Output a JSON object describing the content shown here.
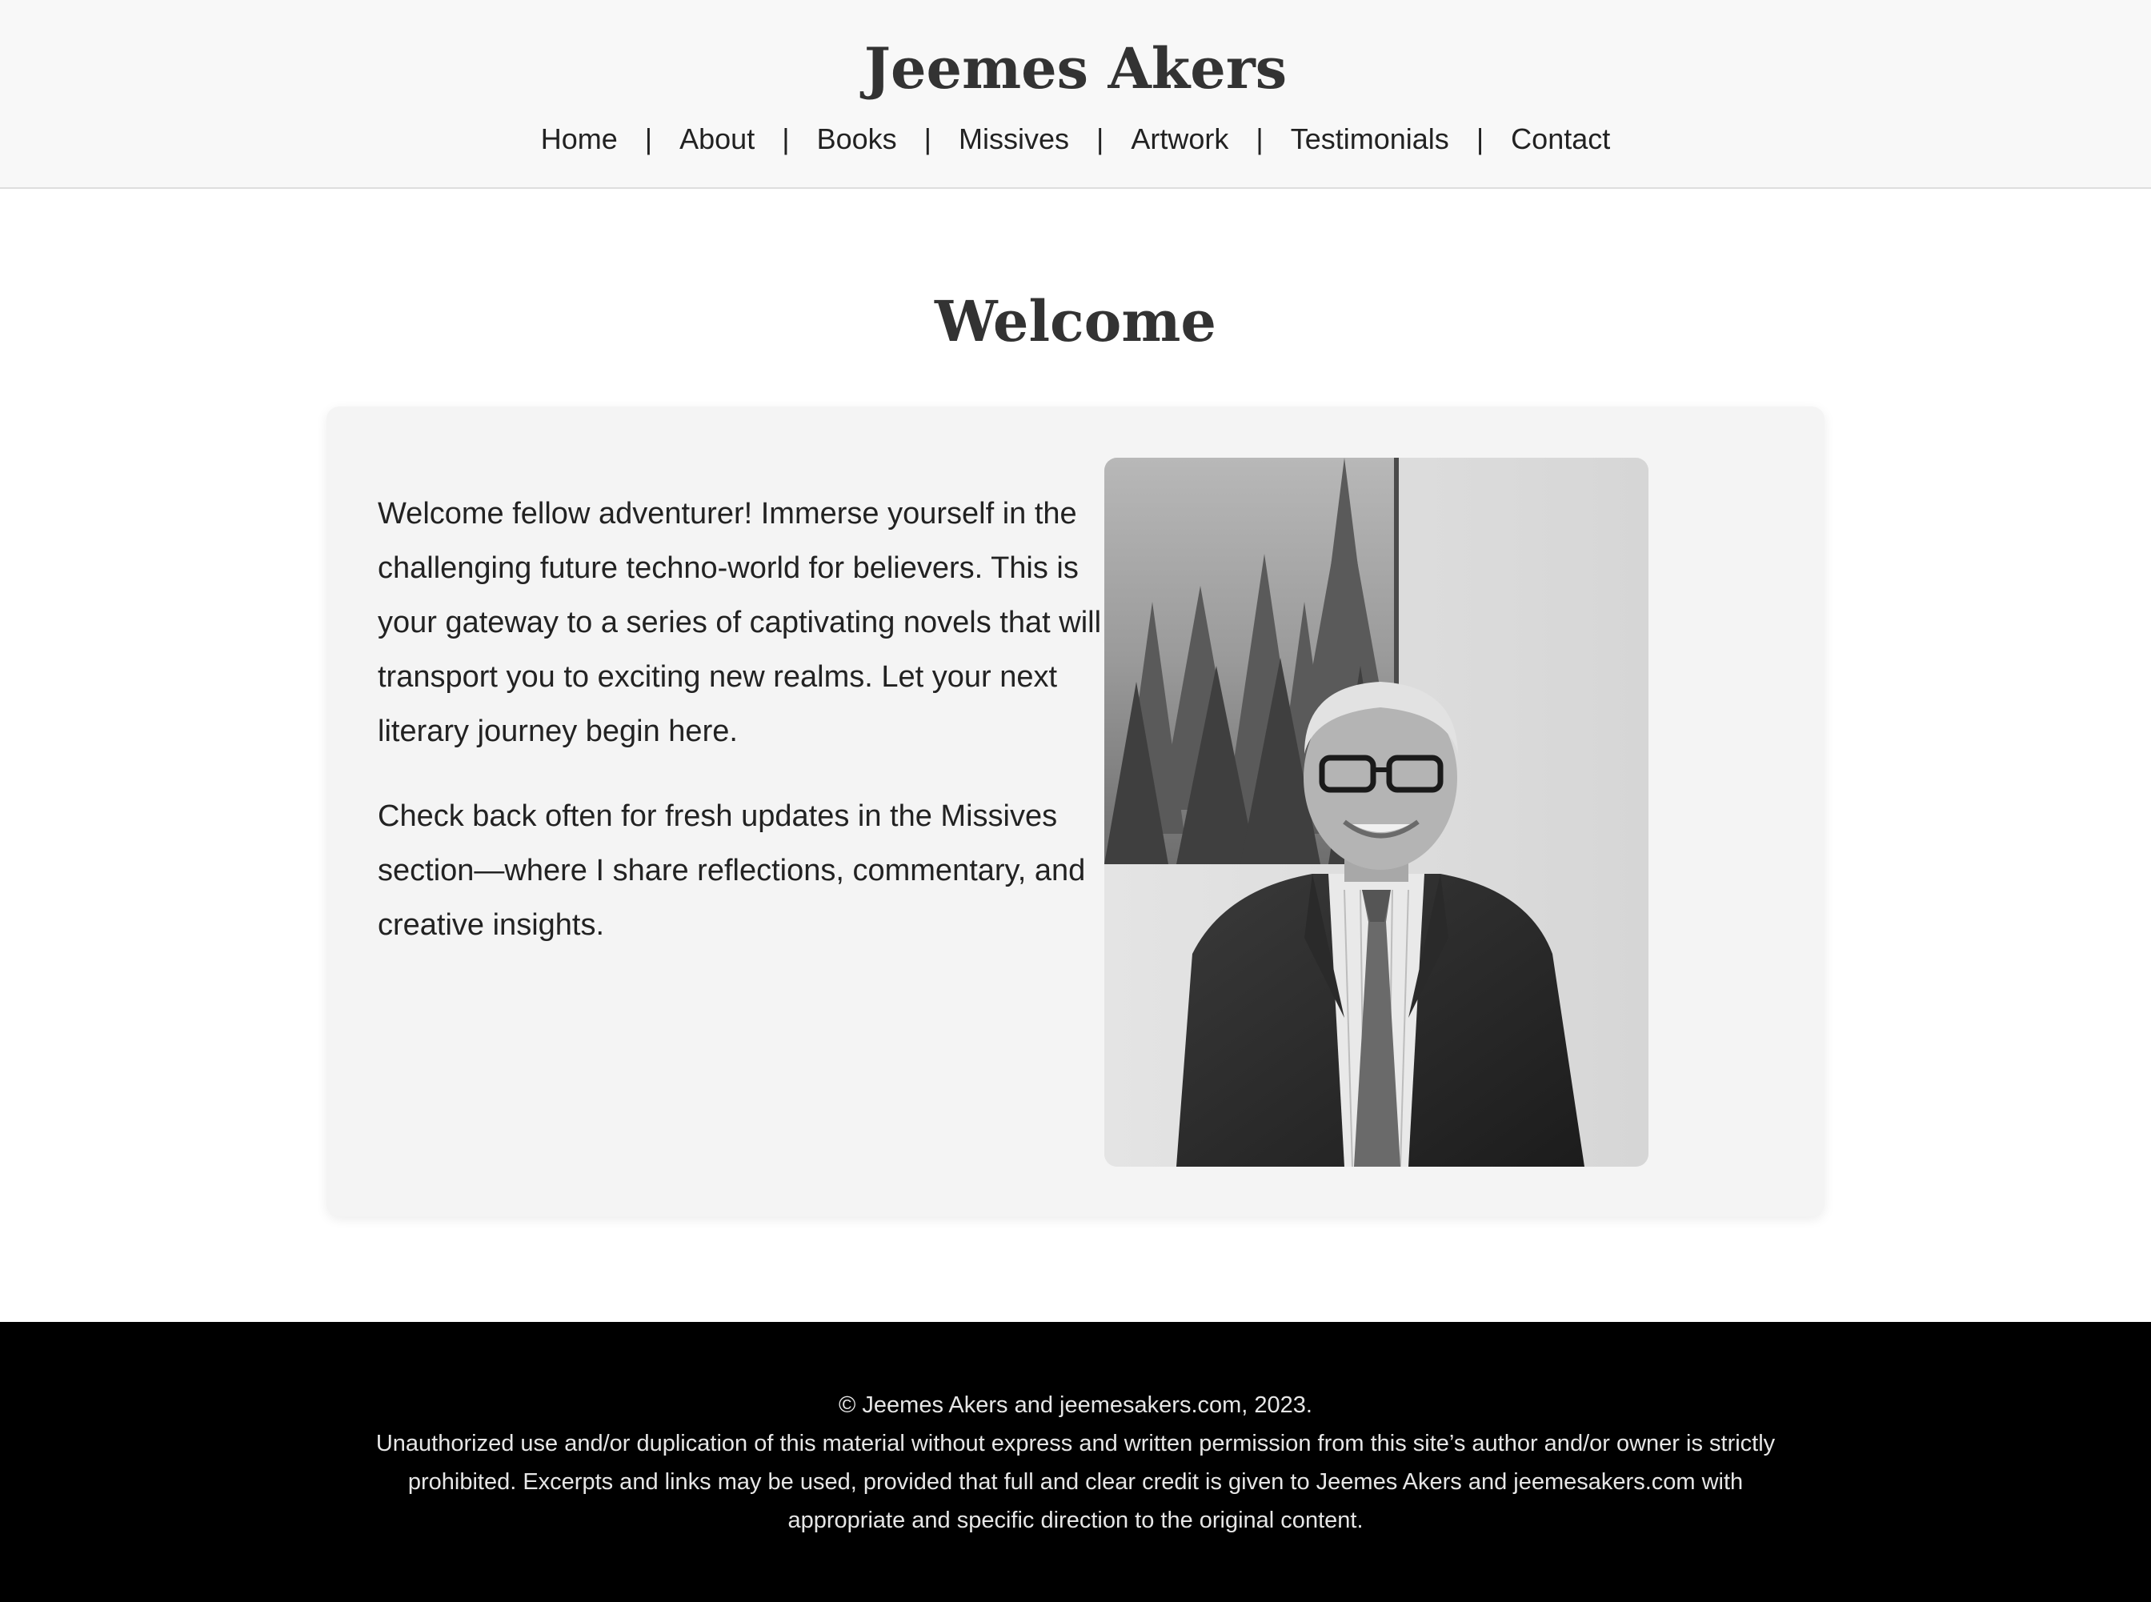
{
  "header": {
    "site_title": "Jeemes Akers",
    "nav": [
      {
        "label": "Home"
      },
      {
        "label": "About"
      },
      {
        "label": "Books"
      },
      {
        "label": "Missives"
      },
      {
        "label": "Artwork"
      },
      {
        "label": "Testimonials"
      },
      {
        "label": "Contact"
      }
    ],
    "separator": "|"
  },
  "main": {
    "heading": "Welcome",
    "paragraphs": [
      "Welcome fellow adventurer! Immerse yourself in the challenging future techno-world for believers. This is your gateway to a series of captivating novels that will transport you to exciting new realms. Let your next literary journey begin here.",
      "Check back often for fresh updates in the Missives section—where I share reflections, commentary, and creative insights."
    ]
  },
  "footer": {
    "copyright": "© Jeemes Akers and jeemesakers.com, 2023.",
    "notice": "Unauthorized use and/or duplication of this material without express and written permission from this site’s author and/or owner is strictly prohibited. Excerpts and links may be used, provided that full and clear credit is given to Jeemes Akers and jeemesakers.com with appropriate and specific direction to the original content."
  },
  "colors": {
    "header_bg": "#f8f8f8",
    "card_bg": "#f4f4f4",
    "footer_bg": "#000000",
    "text": "#333333"
  }
}
